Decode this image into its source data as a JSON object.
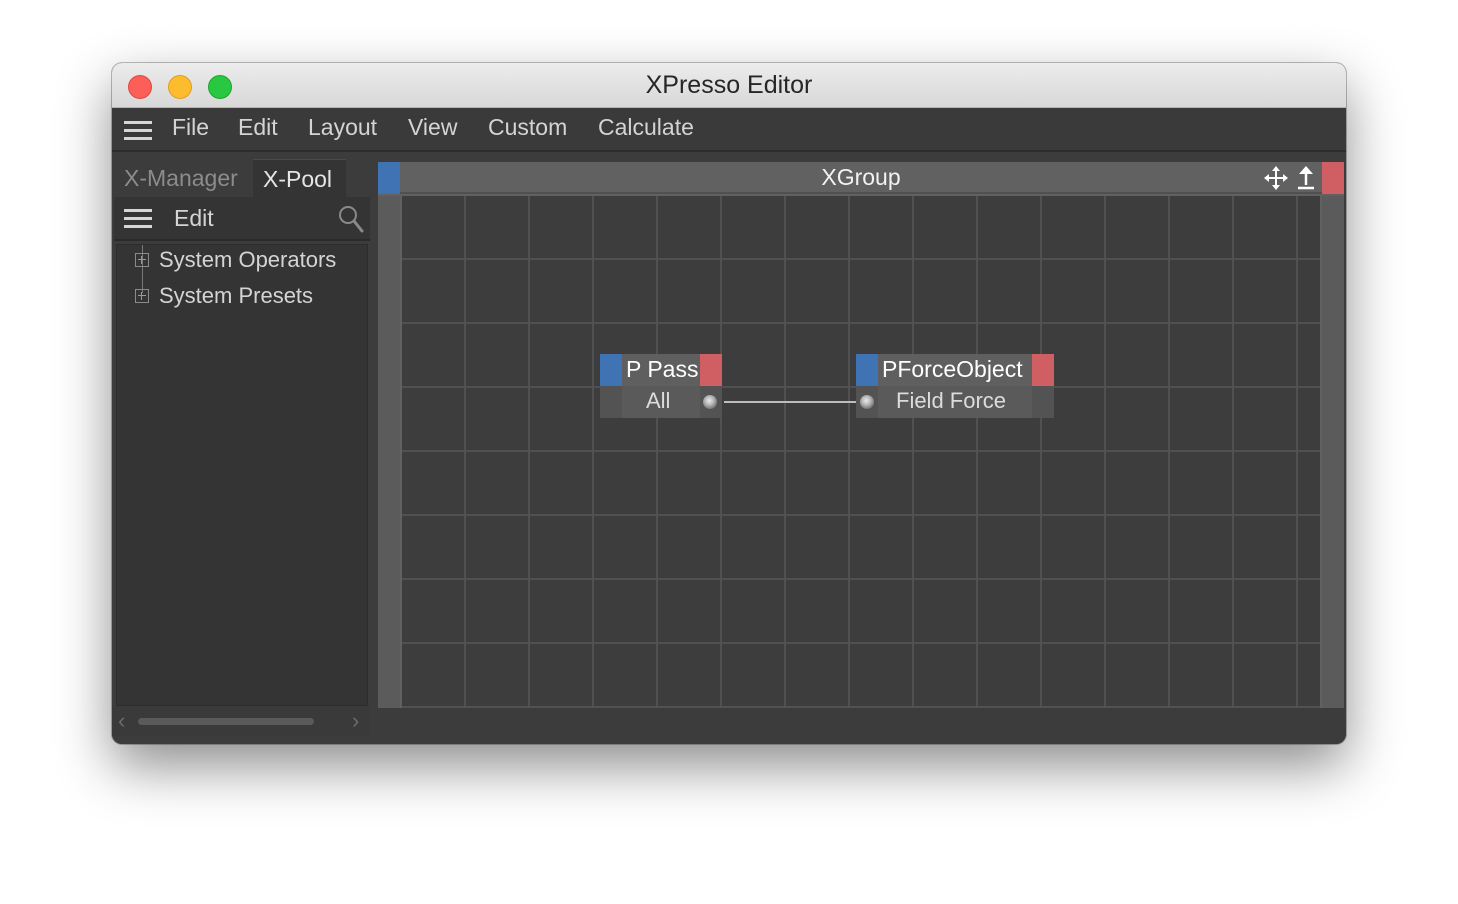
{
  "window": {
    "title": "XPresso Editor",
    "traffic_lights": {
      "close": "#fc5f57",
      "minimize": "#fdbc2e",
      "maximize": "#28c840"
    }
  },
  "menubar": {
    "icon": "hamburger-menu-icon",
    "items": [
      "File",
      "Edit",
      "Layout",
      "View",
      "Custom",
      "Calculate"
    ]
  },
  "left_panel": {
    "tabs": [
      {
        "label": "X-Manager",
        "active": false
      },
      {
        "label": "X-Pool",
        "active": true
      }
    ],
    "toolbar": {
      "menu_icon": "hamburger-menu-icon",
      "edit_label": "Edit",
      "search_icon": "search-icon"
    },
    "tree": [
      {
        "label": "System Operators",
        "expandable": true
      },
      {
        "label": "System Presets",
        "expandable": true
      }
    ]
  },
  "editor": {
    "group_title": "XGroup",
    "colors": {
      "input_side": "#3f73b4",
      "output_side": "#cf5f62",
      "grid": "#3d3d3d"
    },
    "header_icons": [
      "move-icon",
      "fold-icon"
    ],
    "nodes": [
      {
        "title": "P Pass",
        "output_port": "All"
      },
      {
        "title": "PForceObject",
        "input_port": "Field Force"
      }
    ],
    "connections": [
      {
        "from": "P Pass.All",
        "to": "PForceObject.Field Force"
      }
    ]
  }
}
